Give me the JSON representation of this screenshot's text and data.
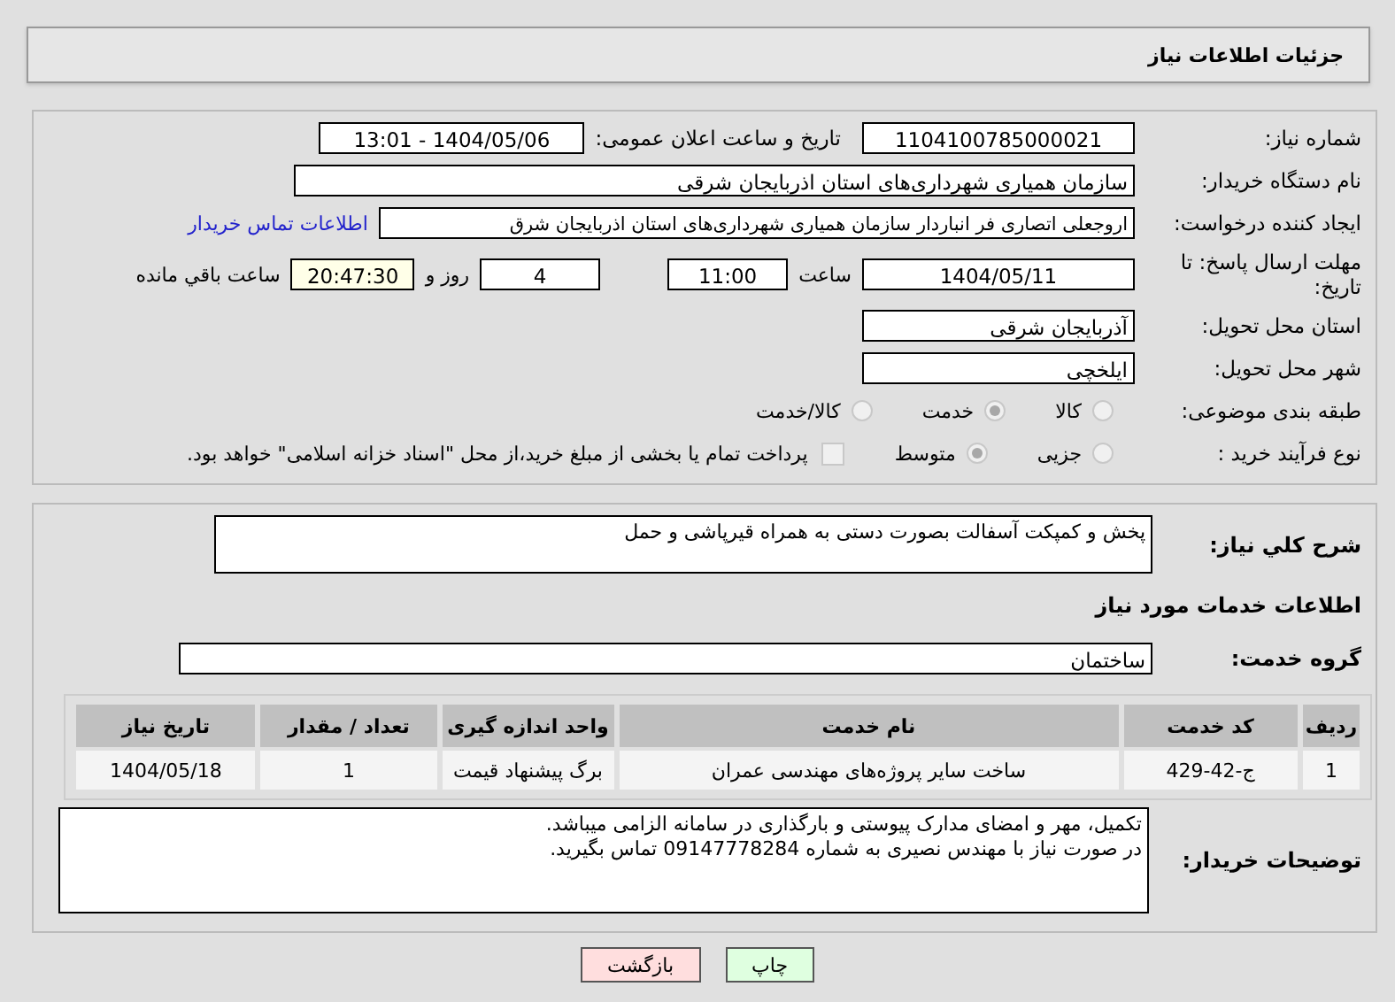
{
  "header": {
    "title": "جزئیات اطلاعات نیاز"
  },
  "need_number": {
    "label": "شماره نیاز:",
    "value": "1104100785000021"
  },
  "announce": {
    "label": "تاریخ و ساعت اعلان عمومی:",
    "value": "1404/05/06 - 13:01"
  },
  "buyer_org": {
    "label": "نام دستگاه خریدار:",
    "value": "سازمان همیاری شهرداری‌های استان اذربایجان شرقی"
  },
  "creator": {
    "label": "ایجاد کننده درخواست:",
    "value": "اروجعلی اتصاری فر انباردار سازمان همیاری شهرداری‌های استان اذربایجان شرق",
    "link": "اطلاعات تماس خریدار"
  },
  "deadline": {
    "label": "مهلت ارسال پاسخ: تا تاریخ:",
    "date": "1404/05/11",
    "time_label": "ساعت",
    "time": "11:00",
    "days": "4",
    "days_label": "روز و",
    "remaining": "20:47:30",
    "remaining_label": "ساعت باقي مانده"
  },
  "province": {
    "label": "استان محل تحویل:",
    "value": "آذربایجان شرقی"
  },
  "city": {
    "label": "شهر محل تحویل:",
    "value": "ایلخچی"
  },
  "category": {
    "label": "طبقه بندی موضوعی:",
    "options": [
      {
        "label": "کالا",
        "selected": false
      },
      {
        "label": "خدمت",
        "selected": true
      },
      {
        "label": "کالا/خدمت",
        "selected": false
      }
    ]
  },
  "purchase_type": {
    "label": "نوع فرآیند خرید :",
    "options": [
      {
        "label": "جزیی",
        "selected": false
      },
      {
        "label": "متوسط",
        "selected": true
      }
    ],
    "treasury": {
      "label": "پرداخت تمام یا بخشی از مبلغ خرید،از محل \"اسناد خزانه اسلامی\" خواهد بود.",
      "checked": false
    }
  },
  "description": {
    "label": "شرح کلي نياز:",
    "value": "پخش و کمپکت آسفالت بصورت دستی به همراه قیرپاشی و حمل"
  },
  "services_heading": "اطلاعات خدمات مورد نیاز",
  "service_group": {
    "label": "گروه خدمت:",
    "value": "ساختمان"
  },
  "table": {
    "columns": [
      "ردیف",
      "کد خدمت",
      "نام خدمت",
      "واحد اندازه گیری",
      "تعداد / مقدار",
      "تاریخ نیاز"
    ],
    "rows": [
      [
        "1",
        "ج-42-429",
        "ساخت سایر پروژه‌های مهندسی عمران",
        "برگ پیشنهاد قیمت",
        "1",
        "1404/05/18"
      ]
    ]
  },
  "buyer_notes": {
    "label": "توضیحات خریدار:",
    "lines": [
      "تکمیل، مهر و امضای مدارک پیوستی و بارگذاری در سامانه الزامی میباشد.",
      "در صورت نیاز با مهندس نصیری به شماره 09147778284 تماس بگیرید."
    ]
  },
  "buttons": [
    {
      "label": "چاپ",
      "kind": "print"
    },
    {
      "label": "بازگشت",
      "kind": "back"
    }
  ]
}
